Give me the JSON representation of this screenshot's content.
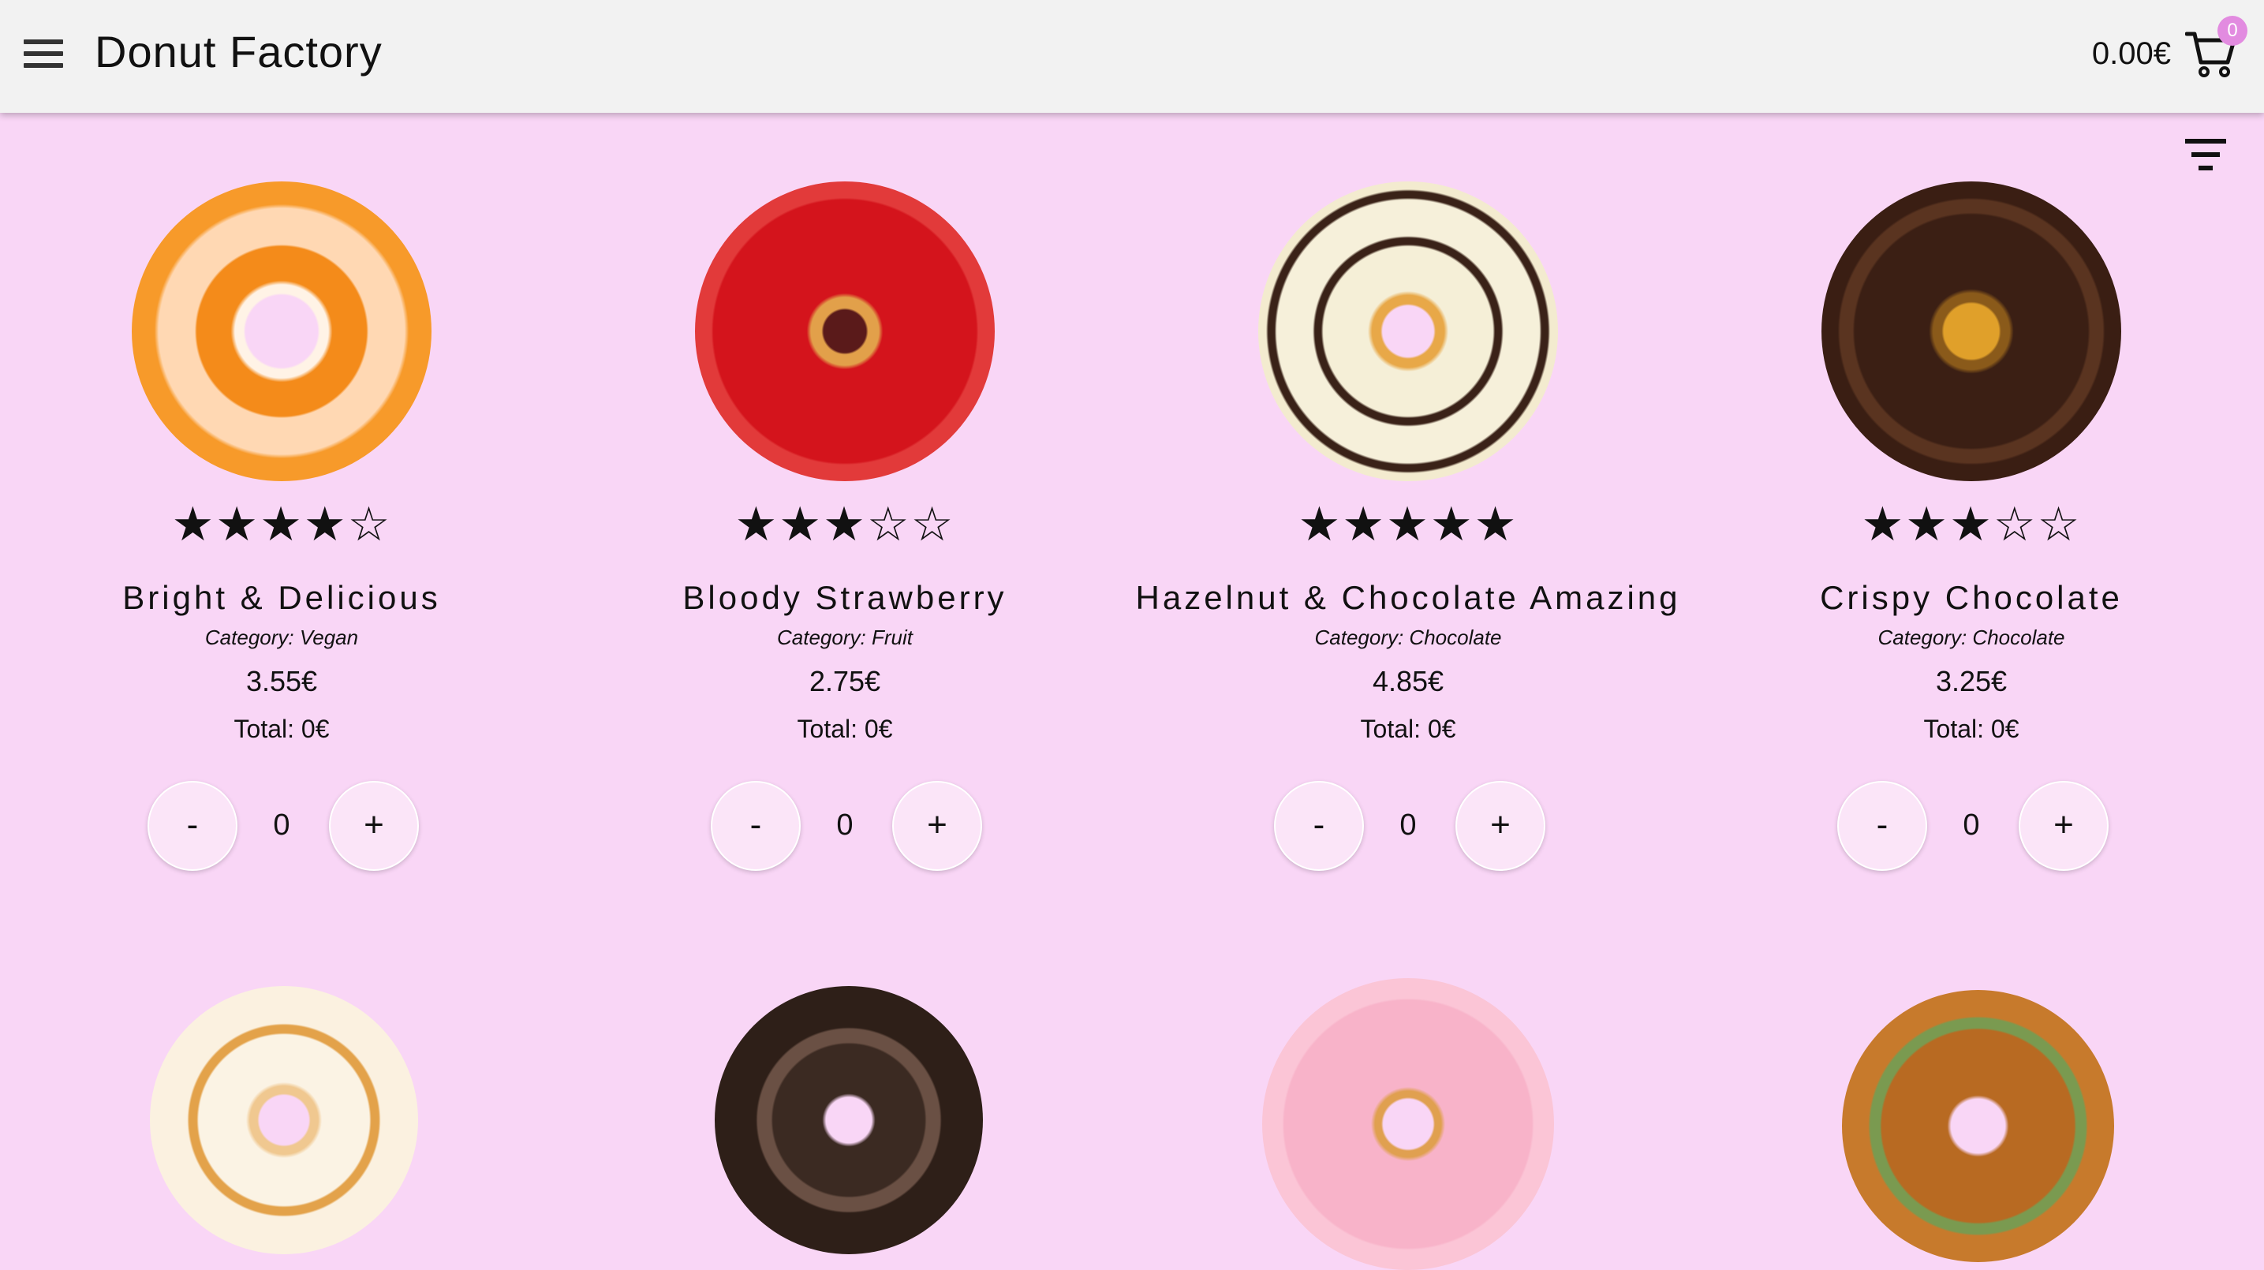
{
  "app": {
    "title": "Donut Factory",
    "cart_total": "0.00€",
    "cart_count": "0"
  },
  "icons": {
    "menu": "hamburger-menu-icon",
    "cart": "shopping-cart-icon",
    "filter": "filter-list-icon"
  },
  "products": [
    {
      "name": "Bright & Delicious",
      "category": "Category: Vegan",
      "price": "3.55€",
      "total": "Total: 0€",
      "quantity": "0",
      "stars": "★★★★☆",
      "rating": 4,
      "minus_label": "-",
      "plus_label": "+"
    },
    {
      "name": "Bloody Strawberry",
      "category": "Category: Fruit",
      "price": "2.75€",
      "total": "Total: 0€",
      "quantity": "0",
      "stars": "★★★☆☆",
      "rating": 3,
      "minus_label": "-",
      "plus_label": "+"
    },
    {
      "name": "Hazelnut & Chocolate Amazing",
      "category": "Category: Chocolate",
      "price": "4.85€",
      "total": "Total: 0€",
      "quantity": "0",
      "stars": "★★★★★",
      "rating": 5,
      "minus_label": "-",
      "plus_label": "+"
    },
    {
      "name": "Crispy Chocolate",
      "category": "Category: Chocolate",
      "price": "3.25€",
      "total": "Total: 0€",
      "quantity": "0",
      "stars": "★★★☆☆",
      "rating": 3,
      "minus_label": "-",
      "plus_label": "+"
    }
  ],
  "colors": {
    "page_background": "#f9d6f6",
    "appbar_background": "#f2f2f2",
    "badge": "#e28be0"
  }
}
